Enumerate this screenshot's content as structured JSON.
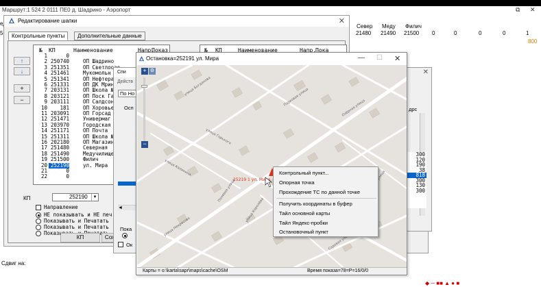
{
  "main_window": {
    "title": "Маршрут:1 524 2   0111 ПЕ0 д. Шадрино - Аэропорт",
    "left_fragment_a": "ед",
    "left_fragment_b": "50",
    "columns": [
      "Север",
      "Меду",
      "Филич"
    ],
    "values": [
      "21480",
      "21490",
      "21500",
      "0",
      "0",
      "0",
      "0",
      "1"
    ],
    "orange_value": "800",
    "bottom_text": "Сдвиг на:"
  },
  "edit_dialog": {
    "title": "Редактирование шапки",
    "tabs": [
      "Контрольные пункты",
      "Дополнительные данные"
    ],
    "list_headers": [
      "№",
      "КП",
      "Наименование",
      "Напр.",
      "Показ"
    ],
    "rows": [
      {
        "n": "1",
        "kp": "0",
        "name": ""
      },
      {
        "n": "2",
        "kp": "250740",
        "name": "ОП Шадрино"
      },
      {
        "n": "3",
        "kp": "251351",
        "name": "ОП Светлоозе"
      },
      {
        "n": "4",
        "kp": "251461",
        "name": "Мукомольн"
      },
      {
        "n": "5",
        "kp": "251341",
        "name": "ОП Нефтеразе"
      },
      {
        "n": "6",
        "kp": "251331",
        "name": "ОП ДК Мрино"
      },
      {
        "n": "7",
        "kp": "203131",
        "name": "ОП Школа №"
      },
      {
        "n": "8",
        "kp": "203121",
        "name": "ОП Поск Гай"
      },
      {
        "n": "9",
        "kp": "203111",
        "name": "ОП Салдсон"
      },
      {
        "n": "10",
        "kp": "181",
        "name": "ОП Хоровье"
      },
      {
        "n": "11",
        "kp": "203091",
        "name": "ОП Горсад"
      },
      {
        "n": "12",
        "kp": "251471",
        "name": "Универмаг"
      },
      {
        "n": "13",
        "kp": "203970",
        "name": "Городская"
      },
      {
        "n": "14",
        "kp": "251171",
        "name": "ОП Почта"
      },
      {
        "n": "15",
        "kp": "251311",
        "name": "ОП Школа №"
      },
      {
        "n": "16",
        "kp": "202180",
        "name": "ОП Магазин"
      },
      {
        "n": "17",
        "kp": "251480",
        "name": "Северная"
      },
      {
        "n": "18",
        "kp": "251490",
        "name": "Медучилище"
      },
      {
        "n": "19",
        "kp": "251500",
        "name": "Филич"
      },
      {
        "n": "20",
        "kp": "252190",
        "name": "ул. Мира"
      },
      {
        "n": "21",
        "kp": "0",
        "name": ""
      },
      {
        "n": "22",
        "kp": "0",
        "name": ""
      }
    ],
    "list2_headers": [
      "№",
      "КП",
      "Наименование",
      "Напр.",
      "Пока"
    ],
    "kp_label": "КП",
    "kp_value": "252190",
    "direction_label": "Направление",
    "options": [
      "НЕ показывать и НЕ печ",
      "Показывать и Печатать",
      "Показывать и Печатать",
      "Показывать и Печатать"
    ],
    "kp_button": "КП",
    "save_button_partial": "Сох",
    "side_buttons": [
      "↑",
      "↓",
      "+",
      "−"
    ]
  },
  "middle_dialog": {
    "title_partial": "Спи",
    "action_partial": "Действ",
    "tab_partial": "По Но",
    "label_partial": "Осп",
    "bottom_label_partial": "Пока",
    "bottom_check_partial": "Ок"
  },
  "right_dialog": {
    "label_partial": "дрс",
    "values": [
      "300",
      "120",
      "190",
      "38",
      "818",
      "300",
      "130",
      "300"
    ]
  },
  "map_window": {
    "title": "Остановка=252191 ул. Мира",
    "stop_label": "25219 1 ул. Мира",
    "street_labels": [
      "улица Богданова",
      "Парковая улица",
      "Озёрная улица",
      "улица Калинина",
      "улица Горького",
      "улица Некрасова",
      "Полевая улица",
      "улица Королёва",
      "Садовая улица",
      "Пролетарская улица"
    ],
    "status_left": "Карты = о:\\karta\\sapr\\maps\\cache\\OSM",
    "status_right": "Время показа=78=Р=16/0/0",
    "context_menu": [
      "Контрольный пункт...",
      "Опорная точка",
      "Прохождение ТС по данной точке",
      "Получить координаты в буфер",
      "Тайл основной карты",
      "Тайл Яндекс-пробки",
      "Остановочный пункт"
    ]
  }
}
